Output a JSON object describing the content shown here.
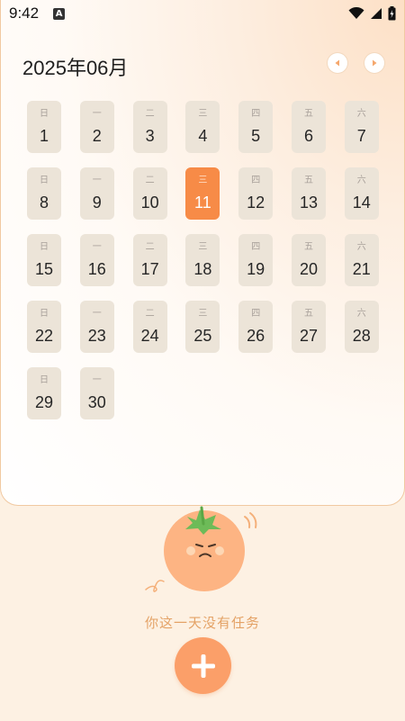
{
  "status_bar": {
    "time": "9:42",
    "notification_icon": "A"
  },
  "calendar": {
    "month_title": "2025年06月",
    "selected_day": "11",
    "days": [
      {
        "wk": "日",
        "num": "1"
      },
      {
        "wk": "一",
        "num": "2"
      },
      {
        "wk": "二",
        "num": "3"
      },
      {
        "wk": "三",
        "num": "4"
      },
      {
        "wk": "四",
        "num": "5"
      },
      {
        "wk": "五",
        "num": "6"
      },
      {
        "wk": "六",
        "num": "7"
      },
      {
        "wk": "日",
        "num": "8"
      },
      {
        "wk": "一",
        "num": "9"
      },
      {
        "wk": "二",
        "num": "10"
      },
      {
        "wk": "三",
        "num": "11"
      },
      {
        "wk": "四",
        "num": "12"
      },
      {
        "wk": "五",
        "num": "13"
      },
      {
        "wk": "六",
        "num": "14"
      },
      {
        "wk": "日",
        "num": "15"
      },
      {
        "wk": "一",
        "num": "16"
      },
      {
        "wk": "二",
        "num": "17"
      },
      {
        "wk": "三",
        "num": "18"
      },
      {
        "wk": "四",
        "num": "19"
      },
      {
        "wk": "五",
        "num": "20"
      },
      {
        "wk": "六",
        "num": "21"
      },
      {
        "wk": "日",
        "num": "22"
      },
      {
        "wk": "一",
        "num": "23"
      },
      {
        "wk": "二",
        "num": "24"
      },
      {
        "wk": "三",
        "num": "25"
      },
      {
        "wk": "四",
        "num": "26"
      },
      {
        "wk": "五",
        "num": "27"
      },
      {
        "wk": "六",
        "num": "28"
      },
      {
        "wk": "日",
        "num": "29"
      },
      {
        "wk": "一",
        "num": "30"
      }
    ]
  },
  "empty_state": {
    "message": "你这一天没有任务"
  },
  "icons": {
    "prev": "chevron-left-icon",
    "next": "chevron-right-icon",
    "add": "plus-icon",
    "mascot": "tomato-mascot"
  },
  "colors": {
    "accent": "#f78b47",
    "day_bg": "#ece4d8",
    "empty_text": "#e4a266",
    "add_button": "#fb9f69"
  }
}
